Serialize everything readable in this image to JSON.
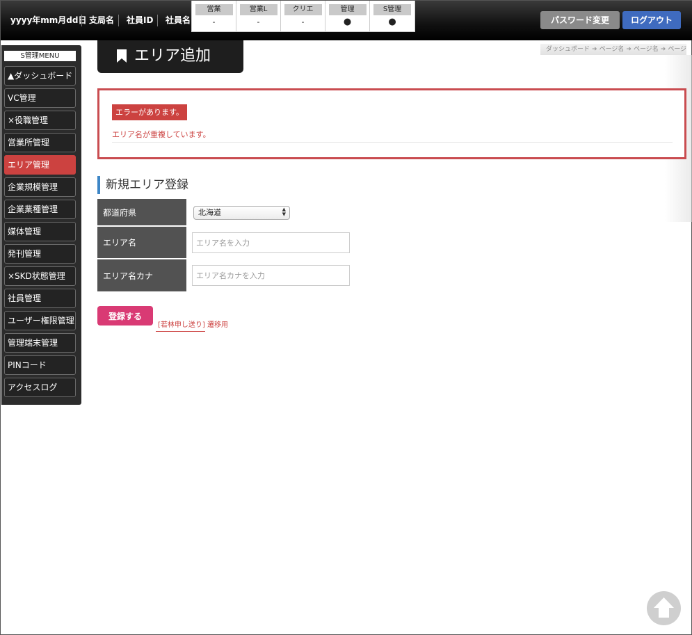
{
  "header": {
    "date": "yyyy年mm月dd日",
    "branch": "支局名",
    "employee_id": "社員ID",
    "employee_name": "社員名",
    "roles": [
      {
        "label": "営業",
        "value": "-"
      },
      {
        "label": "営業L",
        "value": "-"
      },
      {
        "label": "クリエ",
        "value": "-"
      },
      {
        "label": "管理",
        "value": "●"
      },
      {
        "label": "S管理",
        "value": "●"
      }
    ],
    "password_button": "パスワード変更",
    "logout_button": "ログアウト",
    "colors": {
      "logout": "#3f6bbf",
      "password": "#8a8a8a"
    }
  },
  "sidebar": {
    "title": "S管理MENU",
    "items": [
      {
        "label": "▲ダッシュボード"
      },
      {
        "label": "VC管理"
      },
      {
        "label": "×役職管理"
      },
      {
        "label": "営業所管理"
      },
      {
        "label": "エリア管理",
        "active": true
      },
      {
        "label": "企業規模管理"
      },
      {
        "label": "企業業種管理"
      },
      {
        "label": "媒体管理"
      },
      {
        "label": "発刊管理"
      },
      {
        "label": "×SKD状態管理"
      },
      {
        "label": "社員管理"
      },
      {
        "label": "ユーザー権限管理"
      },
      {
        "label": "管理端末管理"
      },
      {
        "label": "PINコード"
      },
      {
        "label": "アクセスログ"
      }
    ],
    "active_color": "#cc4240"
  },
  "page": {
    "title": "エリア追加",
    "title_icon": "bookmark-icon",
    "breadcrumb": [
      "ダッシュボード",
      "ページ名",
      "ページ名",
      "ページ名"
    ]
  },
  "error": {
    "badge": "エラーがあります。",
    "message": "エリア名が重複しています。",
    "color": "#cc4240"
  },
  "form": {
    "section_title": "新規エリア登録",
    "prefecture_label": "都道府県",
    "prefecture_value": "北海道",
    "area_name_label": "エリア名",
    "area_name_placeholder": "エリア名を入力",
    "area_kana_label": "エリア名カナ",
    "area_kana_placeholder": "エリア名カナを入力",
    "submit_label": "登録する",
    "submit_color": "#d93a74",
    "transit_bracket": "[若林申し送り]",
    "transit_text": "遷移用"
  },
  "scroll_top_icon": "arrow-up-icon"
}
